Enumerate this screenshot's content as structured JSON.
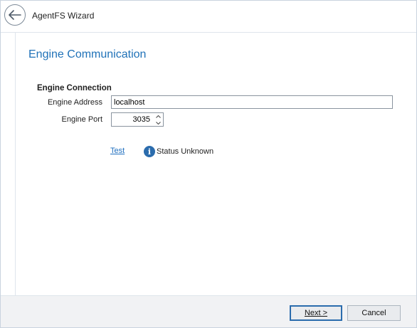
{
  "window": {
    "title": "AgentFS Wizard"
  },
  "page": {
    "heading": "Engine Communication"
  },
  "connection": {
    "section_label": "Engine Connection",
    "address_label": "Engine Address",
    "address_value": "localhost",
    "port_label": "Engine Port",
    "port_value": "3035"
  },
  "test": {
    "link_label": "Test",
    "status_icon": "info-icon",
    "status_text": "Status Unknown"
  },
  "footer": {
    "next_label": "Next >",
    "cancel_label": "Cancel"
  },
  "colors": {
    "accent": "#2072b8",
    "info": "#2b6cad",
    "link": "#1f6fbf"
  }
}
